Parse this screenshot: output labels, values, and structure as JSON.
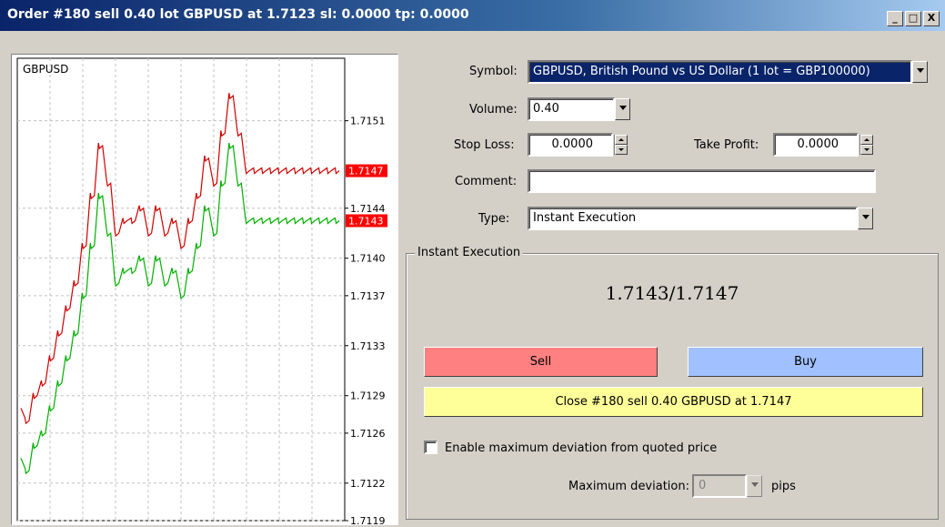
{
  "window": {
    "title": "Order #180 sell 0.40 lot GBPUSD at 1.7123 sl: 0.0000 tp: 0.0000",
    "minimize": "_",
    "maximize": "□",
    "close": "X"
  },
  "form": {
    "symbol_label": "Symbol:",
    "symbol_value": "GBPUSD, British Pound vs US Dollar (1 lot = GBP100000)",
    "volume_label": "Volume:",
    "volume_value": "0.40",
    "stop_loss_label": "Stop Loss:",
    "stop_loss_value": "0.0000",
    "take_profit_label": "Take Profit:",
    "take_profit_value": "0.0000",
    "comment_label": "Comment:",
    "comment_value": "",
    "type_label": "Type:",
    "type_value": "Instant Execution"
  },
  "execution": {
    "group_label": "Instant Execution",
    "quote": "1.7143/1.7147",
    "sell_label": "Sell",
    "buy_label": "Buy",
    "close_label": "Close #180 sell 0.40 GBPUSD at 1.7147",
    "deviation_checkbox_label": "Enable maximum deviation from quoted price",
    "deviation_checked": false,
    "max_deviation_label": "Maximum deviation:",
    "max_deviation_value": "0",
    "pips_label": "pips"
  },
  "colors": {
    "sell": "#ff8080",
    "buy": "#a0c0ff",
    "close": "#ffff99",
    "ask_line": "#d00000",
    "bid_line": "#00b000",
    "price_tag": "#ff0000"
  },
  "chart_data": {
    "type": "line",
    "title": "GBPUSD",
    "y_ticks": [
      1.7151,
      1.7147,
      1.7144,
      1.7143,
      1.714,
      1.7137,
      1.7133,
      1.7129,
      1.7126,
      1.7122,
      1.7119
    ],
    "y_tick_labels": [
      "1.7151",
      "1.7144",
      "1.7140",
      "1.7137",
      "1.7133",
      "1.7129",
      "1.7126",
      "1.7122",
      "1.7119"
    ],
    "ylim": [
      1.7119,
      1.7156
    ],
    "grid": true,
    "price_tags": [
      {
        "value": 1.7147,
        "label": "1.7147"
      },
      {
        "value": 1.7143,
        "label": "1.7143"
      }
    ],
    "series": [
      {
        "values": [
          1.7128,
          1.7127,
          1.7129,
          1.713,
          1.7132,
          1.7134,
          1.7136,
          1.7138,
          1.7141,
          1.7145,
          1.7149,
          1.7146,
          1.7142,
          1.7143,
          1.7143,
          1.7144,
          1.7142,
          1.7144,
          1.7142,
          1.7143,
          1.7141,
          1.7143,
          1.7145,
          1.7148,
          1.7146,
          1.715,
          1.7153,
          1.715,
          1.7147,
          1.7147,
          1.7147,
          1.7147,
          1.7147,
          1.7147,
          1.7147,
          1.7147,
          1.7147,
          1.7147,
          1.7147,
          1.7147
        ]
      },
      {
        "values": [
          1.7124,
          1.7123,
          1.7125,
          1.7126,
          1.7128,
          1.713,
          1.7132,
          1.7134,
          1.7137,
          1.7141,
          1.7145,
          1.7142,
          1.7138,
          1.7139,
          1.7139,
          1.714,
          1.7138,
          1.714,
          1.7138,
          1.7139,
          1.7137,
          1.7139,
          1.7141,
          1.7144,
          1.7142,
          1.7146,
          1.7149,
          1.7146,
          1.7143,
          1.7143,
          1.7143,
          1.7143,
          1.7143,
          1.7143,
          1.7143,
          1.7143,
          1.7143,
          1.7143,
          1.7143,
          1.7143
        ]
      }
    ]
  }
}
